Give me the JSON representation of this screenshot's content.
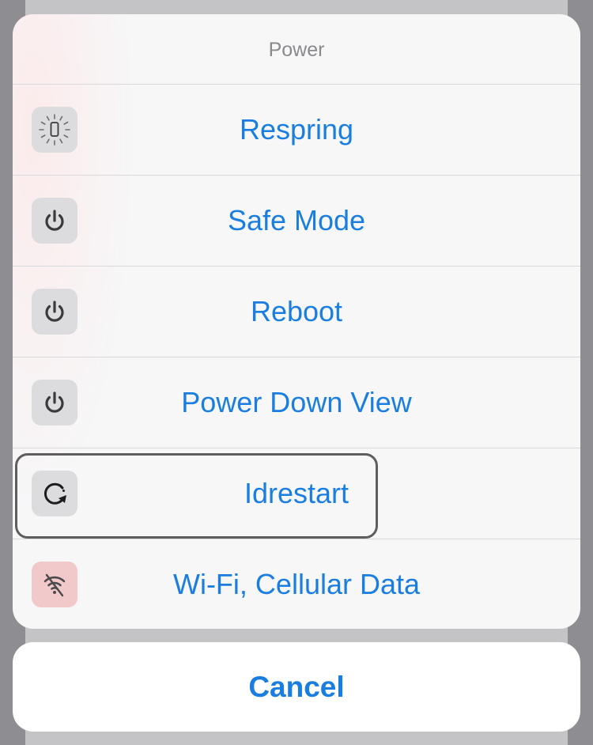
{
  "sheet": {
    "title": "Power",
    "actions": [
      {
        "label": "Respring",
        "icon": "respring-spinner-icon"
      },
      {
        "label": "Safe Mode",
        "icon": "power-icon"
      },
      {
        "label": "Reboot",
        "icon": "power-icon"
      },
      {
        "label": "Power Down View",
        "icon": "power-icon"
      },
      {
        "label": "Idrestart",
        "icon": "restart-arrow-icon"
      },
      {
        "label": "Wi-Fi, Cellular Data",
        "icon": "wifi-off-icon"
      }
    ]
  },
  "cancel_label": "Cancel",
  "colors": {
    "accent": "#1a7ee0",
    "title_gray": "#8a8a8e",
    "icon_tile": "#dcdcde",
    "wifi_tile": "#f2c9cb",
    "highlight_border": "#5e5e60"
  }
}
